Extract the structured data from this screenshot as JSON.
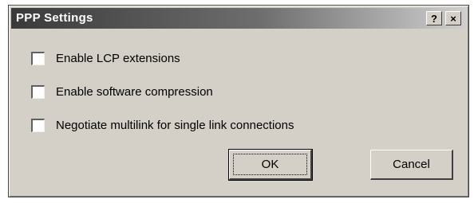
{
  "window": {
    "title": "PPP Settings",
    "help_label": "?",
    "close_label": "×"
  },
  "options": [
    {
      "label": "Enable LCP extensions",
      "checked": false
    },
    {
      "label": "Enable software compression",
      "checked": false
    },
    {
      "label": "Negotiate multilink for single link connections",
      "checked": false
    }
  ],
  "buttons": {
    "ok_label": "OK",
    "cancel_label": "Cancel"
  }
}
